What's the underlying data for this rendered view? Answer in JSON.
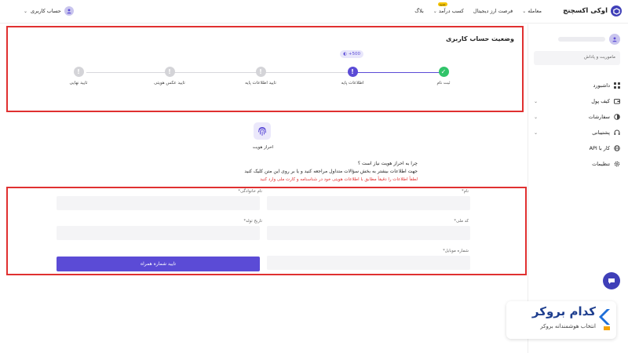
{
  "header": {
    "brand_name": "اوکی اکسچنج",
    "nav": [
      {
        "label": "معامله"
      },
      {
        "label": "فرصت ارز دیجیتال"
      },
      {
        "label": "کسب درآمد",
        "badge": "جدید"
      },
      {
        "label": "بلاگ"
      }
    ],
    "account_label": "حساب کاربری"
  },
  "sidebar": {
    "memo_placeholder": "ماموریت و پاداش",
    "items": [
      {
        "label": "داشبورد",
        "icon": "grid-icon"
      },
      {
        "label": "کیف پول",
        "icon": "wallet-icon"
      },
      {
        "label": "سفارشات",
        "icon": "orders-icon"
      },
      {
        "label": "پشتیبانی",
        "icon": "headset-icon"
      },
      {
        "label": "کار با API",
        "icon": "globe-icon"
      },
      {
        "label": "تنظیمات",
        "icon": "gear-icon"
      }
    ]
  },
  "status": {
    "title": "وضعیت حساب کاربری",
    "reward": "+500",
    "steps": [
      {
        "label": "ثبت نام",
        "state": "done"
      },
      {
        "label": "اطلاعات پایه",
        "state": "active"
      },
      {
        "label": "تایید اطلاعات پایه",
        "state": "pending"
      },
      {
        "label": "تایید عکس هویتی",
        "state": "pending"
      },
      {
        "label": "تایید نهایی",
        "state": "pending"
      }
    ]
  },
  "kyc": {
    "label": "احراز هویت",
    "question": "چرا به احراز هویت نیاز است ؟",
    "description": "جهت اطلاعات بیشتر به بخش سؤالات متداول مراجعه کنید و یا بر روی این متن کلیک کنید",
    "warning": "لطفاً اطلاعات را دقیقاً مطابق با اطلاعات هویتی خود در شناسنامه و کارت ملی وارد کنید"
  },
  "form": {
    "first_name_label": "نام*",
    "last_name_label": "نام خانوادگی*",
    "national_code_label": "کد ملی*",
    "birth_date_label": "تاریخ تولد*",
    "mobile_label": "شماره موبایل*",
    "submit_label": "تایید شماره همراه"
  },
  "watermark": {
    "name": "کدام بروکر",
    "tagline": "انتخاب هوشمندانه بروکر"
  },
  "colors": {
    "accent": "#5b4bd6",
    "success": "#31c46a",
    "highlight_border": "#e03030",
    "brand": "#3f3fb8"
  }
}
